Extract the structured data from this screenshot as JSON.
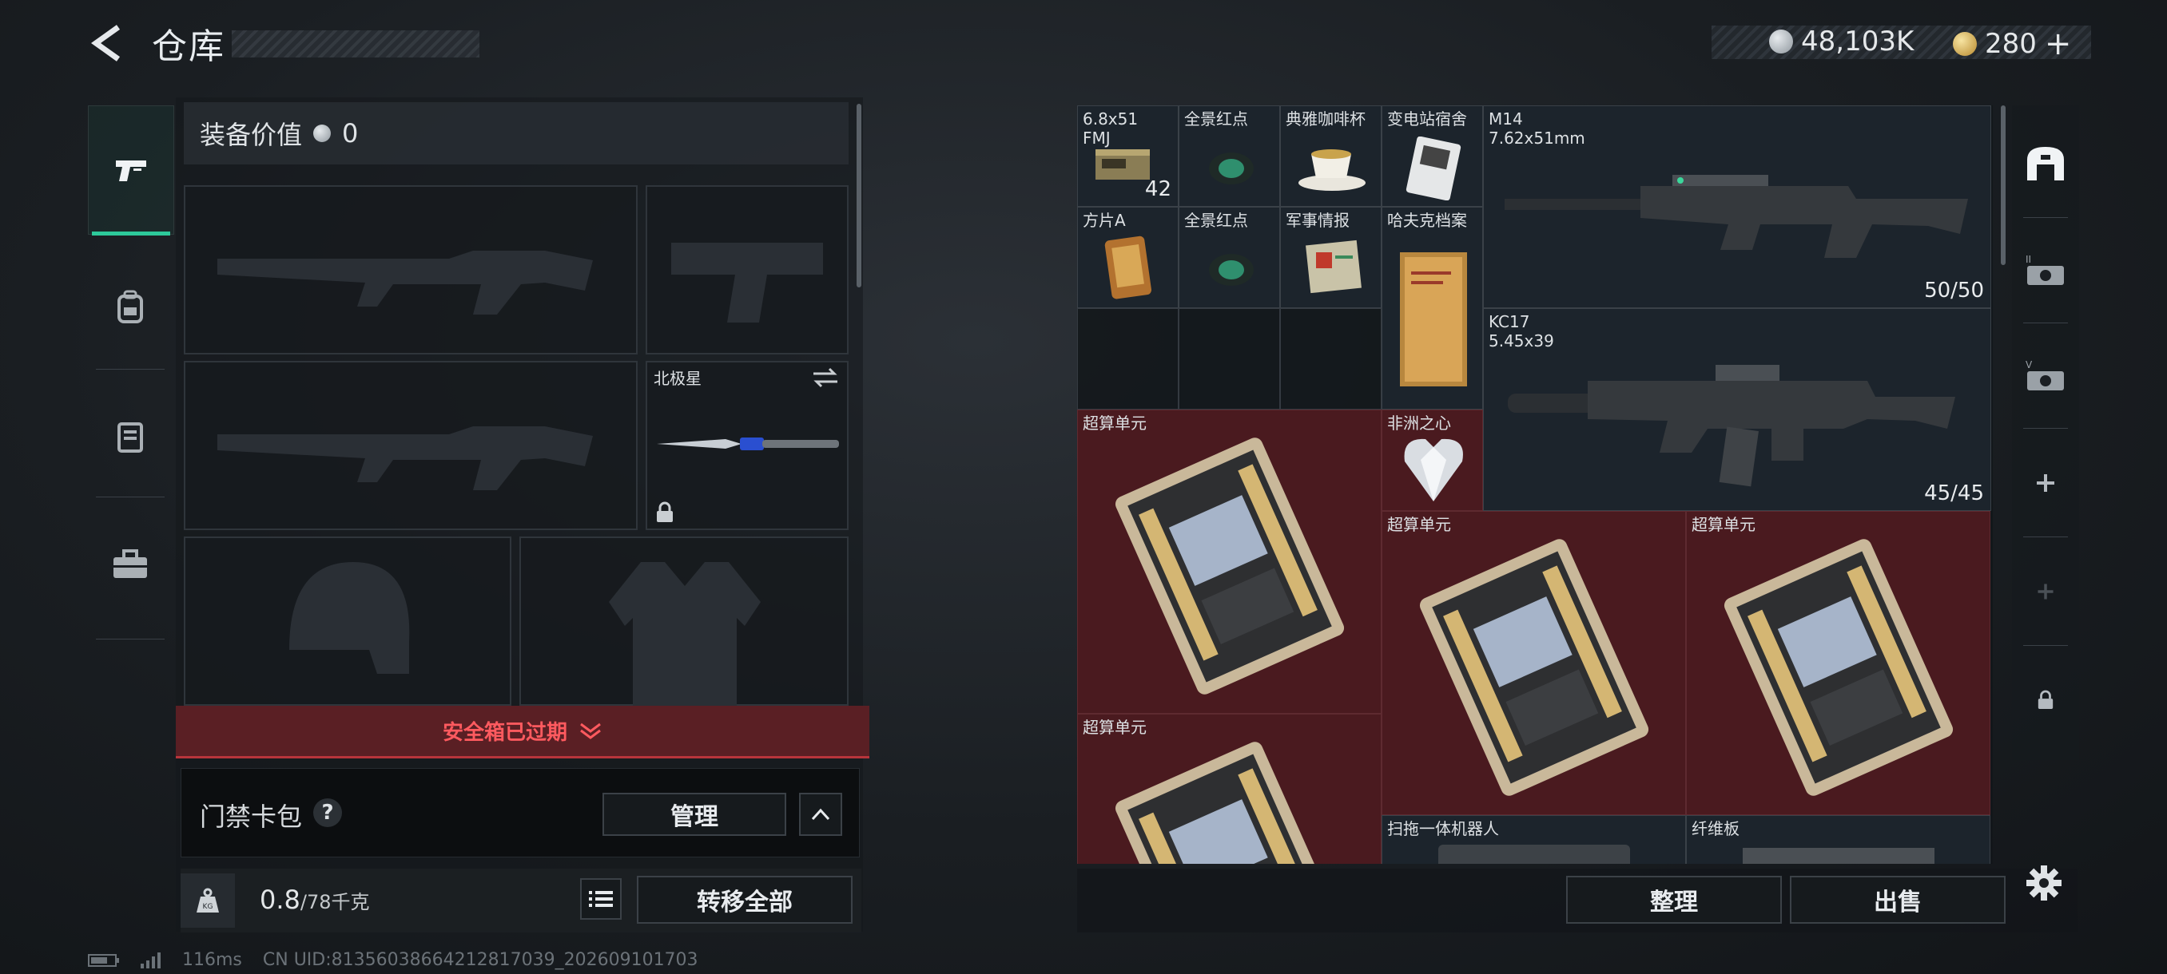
{
  "header": {
    "title": "仓库",
    "currency_silver": "48,103K",
    "currency_gold": "280",
    "gold_plus": "+"
  },
  "left_rail": {
    "items": [
      {
        "name": "weapon-icon"
      },
      {
        "name": "backpack-icon"
      },
      {
        "name": "armor-vest-icon"
      },
      {
        "name": "toolbox-icon"
      }
    ]
  },
  "equipment": {
    "value_label": "装备价值",
    "value": "0",
    "melee_label": "北极星",
    "safebox_status": "安全箱已过期",
    "card_pack_label": "门禁卡包",
    "help": "?",
    "manage_label": "管理",
    "weight_current": "0.8",
    "weight_max": "/78千克",
    "transfer_all_label": "转移全部"
  },
  "status": {
    "ping": "116ms",
    "uid": "CN UID:8135603866421281703­9_202609101703"
  },
  "stash": {
    "items": [
      {
        "id": "ammo",
        "label": "6.8x51 FMJ",
        "count": "42"
      },
      {
        "id": "red-dot-1",
        "label": "全景红点"
      },
      {
        "id": "coffee-cup",
        "label": "典雅咖啡杯"
      },
      {
        "id": "transformer-box",
        "label": "变电站宿舍"
      },
      {
        "id": "m14",
        "label": "M14",
        "sub": "7.62x51mm",
        "count": "50/50"
      },
      {
        "id": "tablet-a",
        "label": "方片A"
      },
      {
        "id": "red-dot-2",
        "label": "全景红点"
      },
      {
        "id": "intel",
        "label": "军事情报"
      },
      {
        "id": "harvard-file",
        "label": "哈夫克档案"
      },
      {
        "id": "kc17",
        "label": "KC17",
        "sub": "5.45x39",
        "count": "45/45"
      },
      {
        "id": "supercompute-1",
        "label": "超算单元"
      },
      {
        "id": "heart-of-africa",
        "label": "非洲之心"
      },
      {
        "id": "supercompute-2",
        "label": "超算单元"
      },
      {
        "id": "supercompute-3",
        "label": "超算单元"
      },
      {
        "id": "supercompute-4",
        "label": "超算单元"
      },
      {
        "id": "robot-vacuum",
        "label": "扫拖一体机器人"
      },
      {
        "id": "fiber-board",
        "label": "纤维板"
      }
    ],
    "sort_label": "整理",
    "sell_label": "出售"
  },
  "colors": {
    "accent_teal": "#2dc99a",
    "danger_red": "#ff5a5f",
    "item_red_bg": "#4a1a1f"
  }
}
